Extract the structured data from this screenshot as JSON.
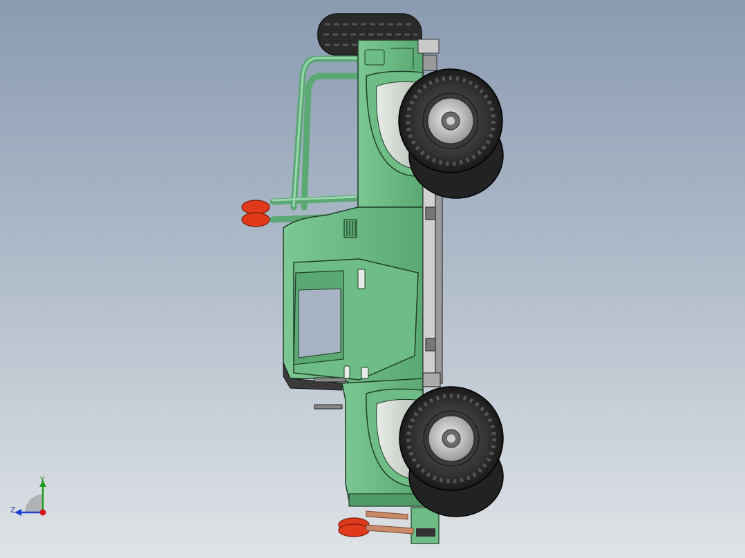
{
  "viewport": {
    "background_top": "#8a9bb1",
    "background_bottom": "#dfe3e7"
  },
  "model": {
    "body_color": "#6fbd86",
    "body_dark": "#5aa872",
    "tire_color": "#2b2b2b",
    "rim_color": "#c8c8c8",
    "light_color": "#e03a1a",
    "exhaust_color": "#c98a6a"
  },
  "triad": {
    "y_label": "Y",
    "z_label": "Z",
    "y_color": "#1e9e1e",
    "z_color": "#1d3fcf",
    "x_color": "#d21414"
  }
}
